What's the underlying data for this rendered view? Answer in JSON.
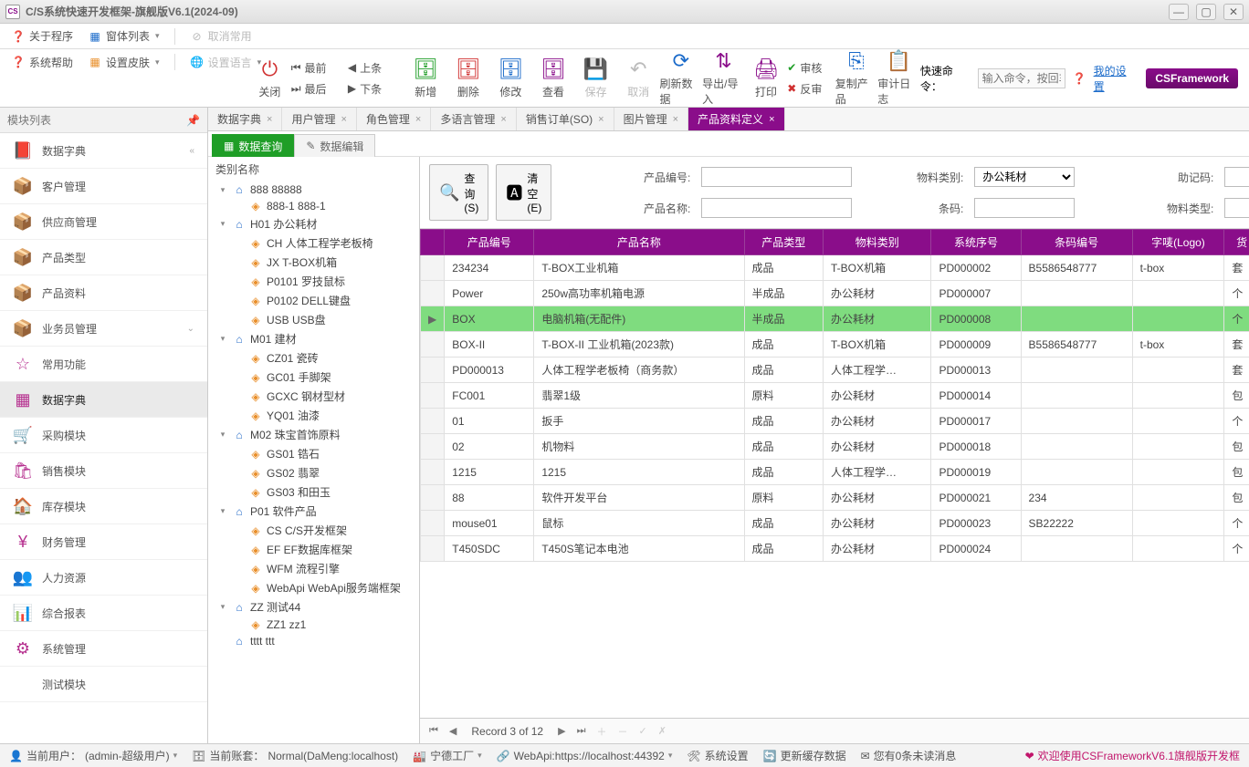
{
  "window": {
    "title": "C/S系统快速开发框架-旗舰版V6.1(2024-09)",
    "app_icon_text": "CS"
  },
  "ribbon1": {
    "about": "关于程序",
    "winlist": "窗体列表",
    "cancel_common": "取消常用",
    "help": "系统帮助",
    "skin": "设置皮肤",
    "lang": "设置语言"
  },
  "navstack": {
    "first": "最前",
    "prev": "上条",
    "last": "最后",
    "next": "下条"
  },
  "ribbon2": {
    "close": "关闭",
    "add": "新增",
    "delete": "删除",
    "edit": "修改",
    "view": "查看",
    "save": "保存",
    "cancel": "取消",
    "refresh": "刷新数据",
    "impexp": "导出/导入",
    "print": "打印",
    "review": "审核",
    "unreview": "反审",
    "copy_prod": "复制产品",
    "audit_log": "审计日志"
  },
  "quickcmd": {
    "label": "快速命令：",
    "placeholder": "输入命令，按回车",
    "my_settings": "我的设置",
    "brand": "CSFramework"
  },
  "left": {
    "title": "模块列表",
    "items": [
      "数据字典",
      "客户管理",
      "供应商管理",
      "产品类型",
      "产品资料",
      "业务员管理",
      "常用功能",
      "数据字典",
      "采购模块",
      "销售模块",
      "库存模块",
      "财务管理",
      "人力资源",
      "综合报表",
      "系统管理",
      "测试模块"
    ]
  },
  "doc_tabs": [
    "数据字典",
    "用户管理",
    "角色管理",
    "多语言管理",
    "销售订单(SO)",
    "图片管理",
    "产品资料定义"
  ],
  "view_tabs": {
    "query": "数据查询",
    "edit": "数据编辑"
  },
  "tree": {
    "header": "类别名称",
    "nodes": [
      {
        "d": 1,
        "t": "house",
        "tw": "▾",
        "label": "888 88888"
      },
      {
        "d": 2,
        "t": "sub",
        "tw": "",
        "label": "888-1 888-1"
      },
      {
        "d": 1,
        "t": "house",
        "tw": "▾",
        "label": "H01 办公耗材"
      },
      {
        "d": 2,
        "t": "sub",
        "tw": "",
        "label": "CH 人体工程学老板椅"
      },
      {
        "d": 2,
        "t": "sub",
        "tw": "",
        "label": "JX T-BOX机箱"
      },
      {
        "d": 2,
        "t": "sub",
        "tw": "",
        "label": "P0101 罗技鼠标"
      },
      {
        "d": 2,
        "t": "sub",
        "tw": "",
        "label": "P0102 DELL键盘"
      },
      {
        "d": 2,
        "t": "sub",
        "tw": "",
        "label": "USB USB盘"
      },
      {
        "d": 1,
        "t": "house",
        "tw": "▾",
        "label": "M01 建材"
      },
      {
        "d": 2,
        "t": "sub",
        "tw": "",
        "label": "CZ01 瓷砖"
      },
      {
        "d": 2,
        "t": "sub",
        "tw": "",
        "label": "GC01 手脚架"
      },
      {
        "d": 2,
        "t": "sub",
        "tw": "",
        "label": "GCXC 钢材型材"
      },
      {
        "d": 2,
        "t": "sub",
        "tw": "",
        "label": "YQ01 油漆"
      },
      {
        "d": 1,
        "t": "house",
        "tw": "▾",
        "label": "M02 珠宝首饰原料"
      },
      {
        "d": 2,
        "t": "sub",
        "tw": "",
        "label": "GS01 锆石"
      },
      {
        "d": 2,
        "t": "sub",
        "tw": "",
        "label": "GS02 翡翠"
      },
      {
        "d": 2,
        "t": "sub",
        "tw": "",
        "label": "GS03 和田玉"
      },
      {
        "d": 1,
        "t": "house",
        "tw": "▾",
        "label": "P01 软件产品"
      },
      {
        "d": 2,
        "t": "sub",
        "tw": "",
        "label": "CS C/S开发框架"
      },
      {
        "d": 2,
        "t": "sub",
        "tw": "",
        "label": "EF EF数据库框架"
      },
      {
        "d": 2,
        "t": "sub",
        "tw": "",
        "label": "WFM 流程引擎"
      },
      {
        "d": 2,
        "t": "sub",
        "tw": "",
        "label": "WebApi WebApi服务端框架"
      },
      {
        "d": 1,
        "t": "house",
        "tw": "▾",
        "label": "ZZ 测试44"
      },
      {
        "d": 2,
        "t": "sub",
        "tw": "",
        "label": "ZZ1 zz1"
      },
      {
        "d": 1,
        "t": "house",
        "tw": "",
        "label": "tttt ttt"
      }
    ]
  },
  "filters": {
    "prod_code": "产品编号:",
    "prod_name": "产品名称:",
    "mat_class": "物料类别:",
    "mat_class_value": "办公耗材",
    "barcode": "条码:",
    "mnemonic": "助记码:",
    "mat_type": "物料类型:",
    "search_btn": "查询(S)",
    "clear_btn": "清空(E)"
  },
  "grid": {
    "columns": [
      "产品编号",
      "产品名称",
      "产品类型",
      "物料类别",
      "系统序号",
      "条码编号",
      "字唛(Logo)",
      "货"
    ],
    "rows": [
      {
        "c": [
          "234234",
          "T-BOX工业机箱",
          "成品",
          "T-BOX机箱",
          "PD000002",
          "B5586548777",
          "t-box",
          "套"
        ]
      },
      {
        "c": [
          "Power",
          "250w高功率机箱电源",
          "半成品",
          "办公耗材",
          "PD000007",
          "",
          "",
          "个"
        ]
      },
      {
        "c": [
          "BOX",
          "电脑机箱(无配件)",
          "半成品",
          "办公耗材",
          "PD000008",
          "",
          "",
          "个"
        ],
        "sel": true
      },
      {
        "c": [
          "BOX-II",
          "T-BOX-II 工业机箱(2023款)",
          "成品",
          "T-BOX机箱",
          "PD000009",
          "B5586548777",
          "t-box",
          "套"
        ]
      },
      {
        "c": [
          "PD000013",
          "人体工程学老板椅（商务款）",
          "成品",
          "人体工程学…",
          "PD000013",
          "",
          "",
          "套"
        ]
      },
      {
        "c": [
          "FC001",
          "翡翠1级",
          "原料",
          "办公耗材",
          "PD000014",
          "",
          "",
          "包"
        ]
      },
      {
        "c": [
          "01",
          "扳手",
          "成品",
          "办公耗材",
          "PD000017",
          "",
          "",
          "个"
        ]
      },
      {
        "c": [
          "02",
          "机物料",
          "成品",
          "办公耗材",
          "PD000018",
          "",
          "",
          "包"
        ]
      },
      {
        "c": [
          "1215",
          "1215",
          "成品",
          "人体工程学…",
          "PD000019",
          "",
          "",
          "包"
        ]
      },
      {
        "c": [
          "88",
          "软件开发平台",
          "原料",
          "办公耗材",
          "PD000021",
          "234",
          "",
          "包"
        ]
      },
      {
        "c": [
          "mouse01",
          "鼠标",
          "成品",
          "办公耗材",
          "PD000023",
          "SB22222",
          "",
          "个"
        ]
      },
      {
        "c": [
          "T450SDC",
          "T450S笔记本电池",
          "成品",
          "办公耗材",
          "PD000024",
          "",
          "",
          "个"
        ]
      }
    ]
  },
  "navigator": {
    "record": "Record 3 of 12"
  },
  "status": {
    "user_label": "当前用户：",
    "user_value": "(admin-超级用户)",
    "acct_label": "当前账套：",
    "acct_value": "Normal(DaMeng:localhost)",
    "factory": "宁德工厂",
    "webapi": "WebApi:https://localhost:44392",
    "sys_settings": "系统设置",
    "update_cache": "更新缓存数据",
    "unread": "您有0条未读消息",
    "welcome": "欢迎使用CSFrameworkV6.1旗舰版开发框"
  }
}
